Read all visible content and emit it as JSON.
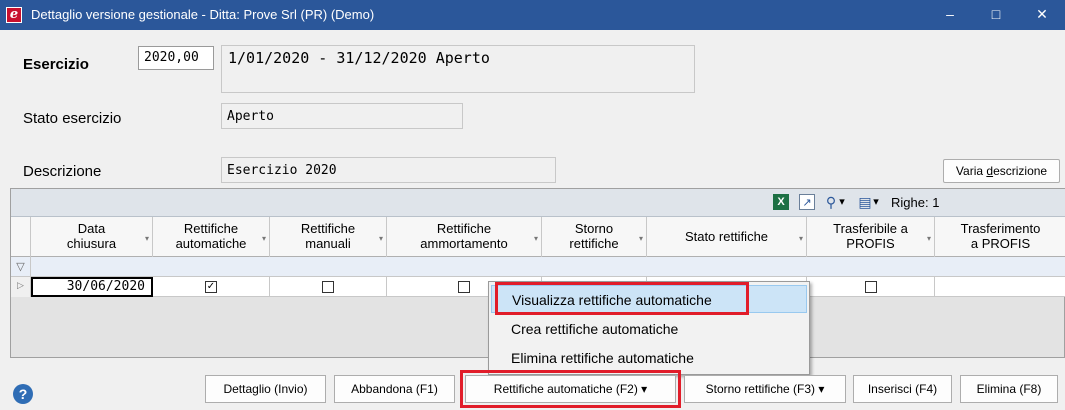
{
  "window": {
    "title": "Dettaglio versione gestionale - Ditta: Prove Srl (PR)  (Demo)",
    "app_icon": "e",
    "minimize_glyph": "–",
    "maximize_glyph": "□",
    "close_glyph": "✕"
  },
  "form": {
    "esercizio_label": "Esercizio",
    "esercizio_value": "2020,00",
    "esercizio_period": "1/01/2020 - 31/12/2020 Aperto",
    "stato_label": "Stato esercizio",
    "stato_value": "Aperto",
    "descrizione_label": "Descrizione",
    "descrizione_value": "Esercizio 2020",
    "varia_pre": "Varia ",
    "varia_under": "d",
    "varia_post": "escrizione"
  },
  "grid_toolbar": {
    "excel_icon": "X",
    "export_icon": "↗",
    "search_icon": "⚲",
    "layout_icon": "▤",
    "dropdown_glyph": "▾",
    "rows_label": "Righe: 1"
  },
  "grid": {
    "columns": [
      {
        "line1": "Data",
        "line2": "chiusura"
      },
      {
        "line1": "Rettifiche",
        "line2": "automatiche"
      },
      {
        "line1": "Rettifiche",
        "line2": "manuali"
      },
      {
        "line1": "Rettifiche",
        "line2": "ammortamento"
      },
      {
        "line1": "Storno",
        "line2": "rettifiche"
      },
      {
        "line1": "Stato rettifiche",
        "line2": ""
      },
      {
        "line1": "Trasferibile a",
        "line2": "PROFIS"
      },
      {
        "line1": "Trasferimento",
        "line2": "a PROFIS"
      }
    ],
    "filter_icon": "▽",
    "row_indicator": "▷",
    "rows": [
      {
        "data_chiusura": "30/06/2020",
        "automatiche_mark": "✓",
        "manuali_mark": "",
        "ammortamento_mark": "",
        "trasferibile_mark": ""
      }
    ]
  },
  "context_menu": {
    "items": [
      {
        "label": "Visualizza rettifiche automatiche"
      },
      {
        "label": "Crea rettifiche automatiche"
      },
      {
        "label": "Elimina rettifiche automatiche"
      }
    ]
  },
  "footer": {
    "help_glyph": "?",
    "buttons": [
      {
        "label": "Dettaglio (Invio)"
      },
      {
        "label": "Abbandona (F1)"
      },
      {
        "label": "Rettifiche automatiche (F2) ▾"
      },
      {
        "label": "Storno rettifiche (F3) ▾"
      },
      {
        "label": "Inserisci (F4)"
      },
      {
        "label": "Elimina (F8)"
      }
    ]
  },
  "colors": {
    "titlebar": "#2b579a",
    "highlight": "#cce4f7",
    "annotation_red": "#e11d2a"
  }
}
